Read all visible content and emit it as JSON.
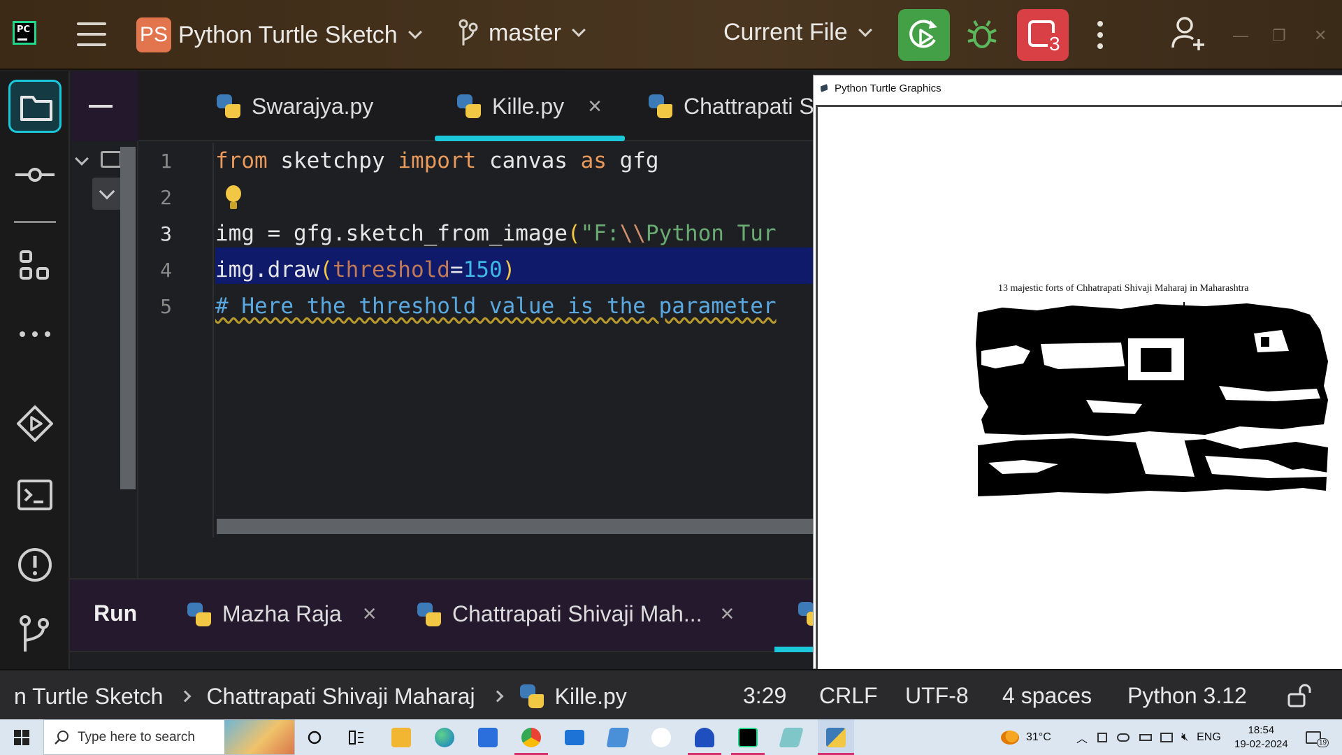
{
  "titlebar": {
    "project_badge": "PS",
    "project_name": "Python Turtle Sketch",
    "branch": "master",
    "run_config": "Current File",
    "stop_count": "3",
    "window_controls": [
      "—",
      "❐",
      "✕"
    ]
  },
  "editor": {
    "tabs": [
      {
        "label": "Swarajya.py",
        "active": false
      },
      {
        "label": "Kille.py",
        "active": true
      },
      {
        "label": "Chattrapati S",
        "active": false
      }
    ],
    "tab_close": "×",
    "line_numbers": [
      "1",
      "2",
      "3",
      "4",
      "5"
    ],
    "code": {
      "l1_kw1": "from",
      "l1_mod": " sketchpy ",
      "l1_kw2": "import",
      "l1_name": " canvas ",
      "l1_kw3": "as",
      "l1_alias": " gfg",
      "l3_pre": "img = gfg.sketch_from_image",
      "l3_paren": "(",
      "l3_str": "\"F:",
      "l3_esc": "\\\\",
      "l3_str2": "Python Tur",
      "l4_pre": "img.draw",
      "l4_paren_open": "(",
      "l4_param": "threshold",
      "l4_eq": "=",
      "l4_num": "150",
      "l4_paren_close": ")",
      "l5_comment": "# Here the threshold value is the parameter"
    }
  },
  "run_panel": {
    "title": "Run",
    "tabs": [
      "Mazha Raja",
      "Chattrapati Shivaji  Mah..."
    ],
    "close": "×"
  },
  "turtle_window": {
    "title": "Python Turtle Graphics",
    "caption": "13 majestic forts of Chhatrapati Shivaji Maharaj in Maharashtra"
  },
  "statusbar": {
    "crumb1": "n Turtle Sketch",
    "crumb2": "Chattrapati Shivaji Maharaj",
    "crumb3": "Kille.py",
    "position": "3:29",
    "line_sep": "CRLF",
    "encoding": "UTF-8",
    "indent": "4 spaces",
    "interpreter": "Python 3.12"
  },
  "taskbar": {
    "search_placeholder": "Type here to search",
    "temperature": "31°C",
    "language": "ENG",
    "time": "18:54",
    "date": "19-02-2024",
    "notif_count": "19"
  },
  "colors": {
    "accent": "#1bc7d9",
    "run_green": "#43a047",
    "stop_red": "#d94046",
    "caret_line": "#0f1a6b"
  }
}
